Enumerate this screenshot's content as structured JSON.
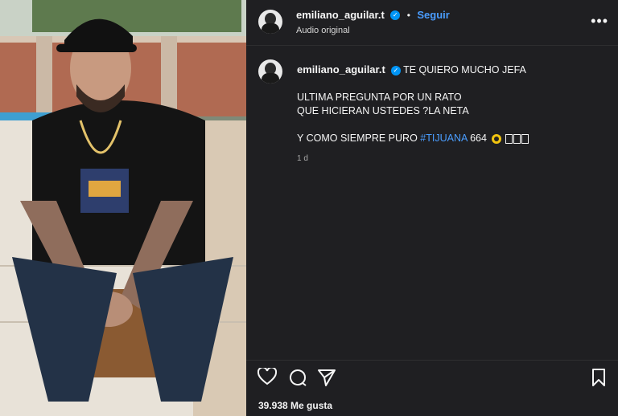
{
  "post": {
    "username": "emiliano_aguilar.t",
    "follow_label": "Seguir",
    "separator": "•",
    "audio": "Audio original",
    "more": "•••"
  },
  "caption": {
    "username": "emiliano_aguilar.t",
    "line1": "TE QUIERO MUCHO JEFA",
    "line2": "ULTIMA PREGUNTA POR UN RATO",
    "line3": "QUE HICIERAN USTEDES ?LA NETA",
    "line4_prefix": "Y COMO SIEMPRE PURO ",
    "hashtag": "#TIJUANA",
    "line4_suffix": " 664",
    "time": "1 d"
  },
  "actions": {
    "likes": "39.938 Me gusta"
  },
  "colors": {
    "accent": "#4a9dff",
    "verified": "#0095f6",
    "panel_bg": "#1f1f22"
  },
  "icons": {
    "like": "heart-icon",
    "comment": "comment-icon",
    "share": "send-icon",
    "save": "bookmark-icon"
  }
}
